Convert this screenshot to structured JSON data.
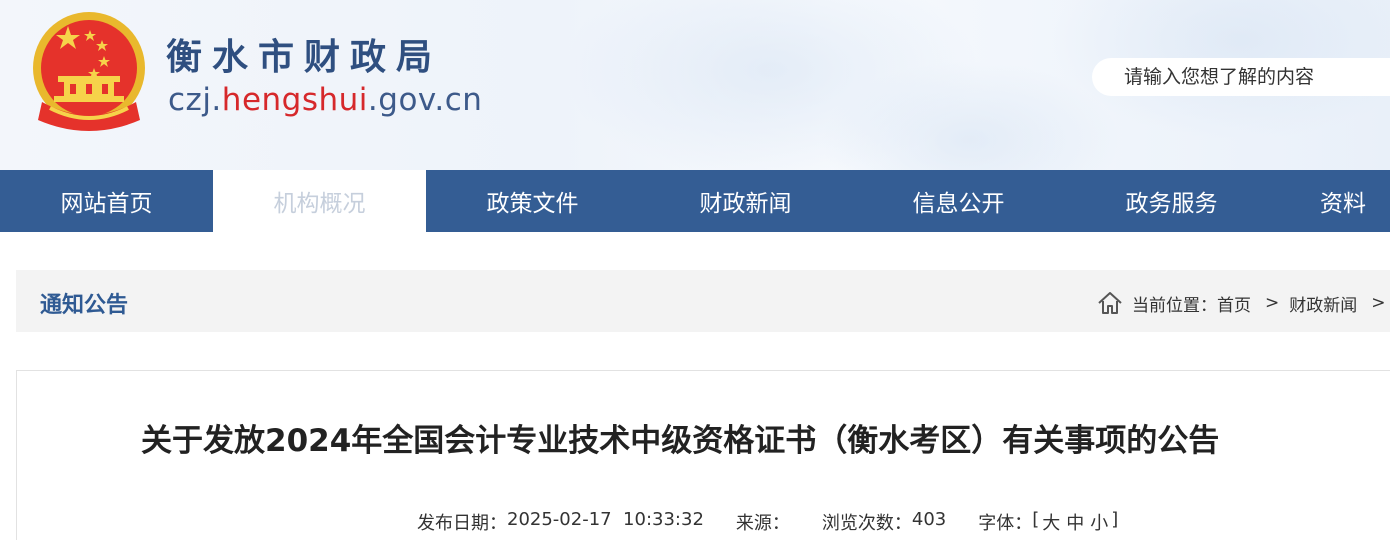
{
  "header": {
    "site_title": "衡水市财政局",
    "domain_prefix": "czj.",
    "domain_highlight": "hengshui",
    "domain_suffix": ".gov.cn",
    "search_placeholder": "请输入您想了解的内容"
  },
  "nav": {
    "items": [
      {
        "label": "网站首页"
      },
      {
        "label": "机构概况"
      },
      {
        "label": "政策文件"
      },
      {
        "label": "财政新闻"
      },
      {
        "label": "信息公开"
      },
      {
        "label": "政务服务"
      },
      {
        "label": "资料"
      }
    ],
    "active_index": 1
  },
  "section": {
    "title": "通知公告",
    "breadcrumb_prefix": "当前位置：",
    "breadcrumb": [
      "首页",
      "财政新闻"
    ],
    "separator": ">"
  },
  "article": {
    "title": "关于发放2024年全国会计专业技术中级资格证书（衡水考区）有关事项的公告",
    "date_label": "发布日期：",
    "date_value": "2025-02-17  10:33:32",
    "source_label": "来源：",
    "source_value": "",
    "views_label": "浏览次数：",
    "views_value": "403",
    "font_label": "字体：",
    "font_open": "[",
    "font_large": "大",
    "font_medium": "中",
    "font_small": "小",
    "font_close": "]"
  },
  "colors": {
    "nav_bg": "#345d94",
    "title_blue": "#2f4f80",
    "domain_red": "#d6282b",
    "section_title": "#2f5a93"
  },
  "icons": [
    "national-emblem-icon",
    "home-icon"
  ]
}
